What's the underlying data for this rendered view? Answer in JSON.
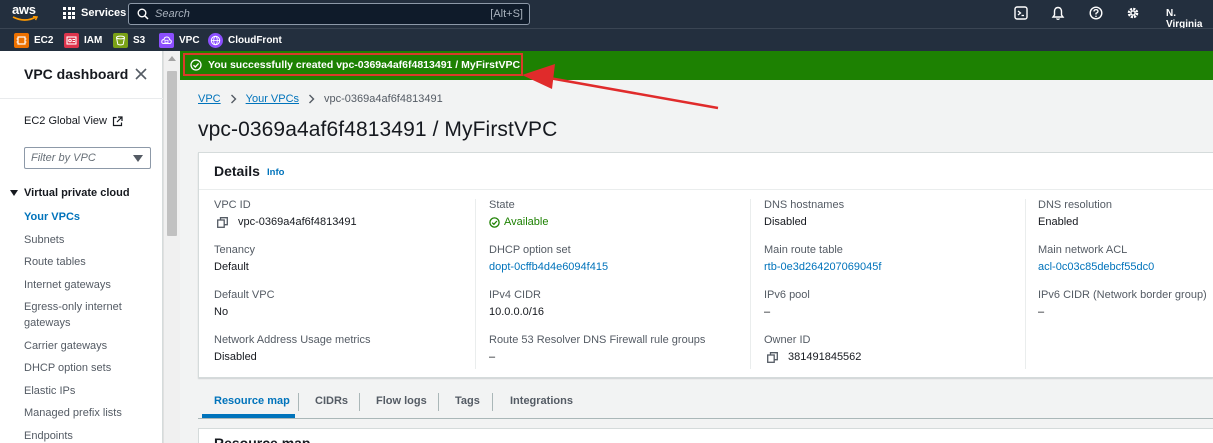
{
  "topnav": {
    "logo": "aws",
    "services_label": "Services",
    "search_placeholder": "Search",
    "search_shortcut": "[Alt+S]",
    "region": "N. Virginia"
  },
  "favorites": [
    {
      "label": "EC2",
      "color": "#ed7100"
    },
    {
      "label": "IAM",
      "color": "#dd344c"
    },
    {
      "label": "S3",
      "color": "#7aa116"
    },
    {
      "label": "VPC",
      "color": "#8c4fff"
    },
    {
      "label": "CloudFront",
      "color": "#8c4fff"
    }
  ],
  "sidebar": {
    "title": "VPC dashboard",
    "global_view": "EC2 Global View",
    "filter_placeholder": "Filter by VPC",
    "section": "Virtual private cloud",
    "items": [
      "Your VPCs",
      "Subnets",
      "Route tables",
      "Internet gateways",
      "Egress-only internet gateways",
      "Carrier gateways",
      "DHCP option sets",
      "Elastic IPs",
      "Managed prefix lists",
      "Endpoints"
    ]
  },
  "flash": {
    "message": "You successfully created vpc-0369a4af6f4813491 / MyFirstVPC",
    "color": "#1d8102"
  },
  "breadcrumb": {
    "items": [
      "VPC",
      "Your VPCs",
      "vpc-0369a4af6f4813491"
    ]
  },
  "page_title": "vpc-0369a4af6f4813491 / MyFirstVPC",
  "details": {
    "title": "Details",
    "info": "Info",
    "columns": [
      [
        {
          "label": "VPC ID",
          "value": "vpc-0369a4af6f4813491"
        },
        {
          "label": "Tenancy",
          "value": "Default"
        },
        {
          "label": "Default VPC",
          "value": "No"
        },
        {
          "label": "Network Address Usage metrics",
          "value": "Disabled"
        }
      ],
      [
        {
          "label": "State",
          "value": "Available"
        },
        {
          "label": "DHCP option set",
          "value": "dopt-0cffb4d4e6094f415"
        },
        {
          "label": "IPv4 CIDR",
          "value": "10.0.0.0/16"
        },
        {
          "label": "Route 53 Resolver DNS Firewall rule groups",
          "value": "–"
        }
      ],
      [
        {
          "label": "DNS hostnames",
          "value": "Disabled"
        },
        {
          "label": "Main route table",
          "value": "rtb-0e3d264207069045f"
        },
        {
          "label": "IPv6 pool",
          "value": "–"
        },
        {
          "label": "Owner ID",
          "value": "381491845562"
        }
      ],
      [
        {
          "label": "DNS resolution",
          "value": "Enabled"
        },
        {
          "label": "Main network ACL",
          "value": "acl-0c03c85debcf55dc0"
        },
        {
          "label": "IPv6 CIDR (Network border group)",
          "value": "–"
        }
      ]
    ]
  },
  "tabs": [
    "Resource map",
    "CIDRs",
    "Flow logs",
    "Tags",
    "Integrations"
  ],
  "next_panel_title": "Resource map"
}
